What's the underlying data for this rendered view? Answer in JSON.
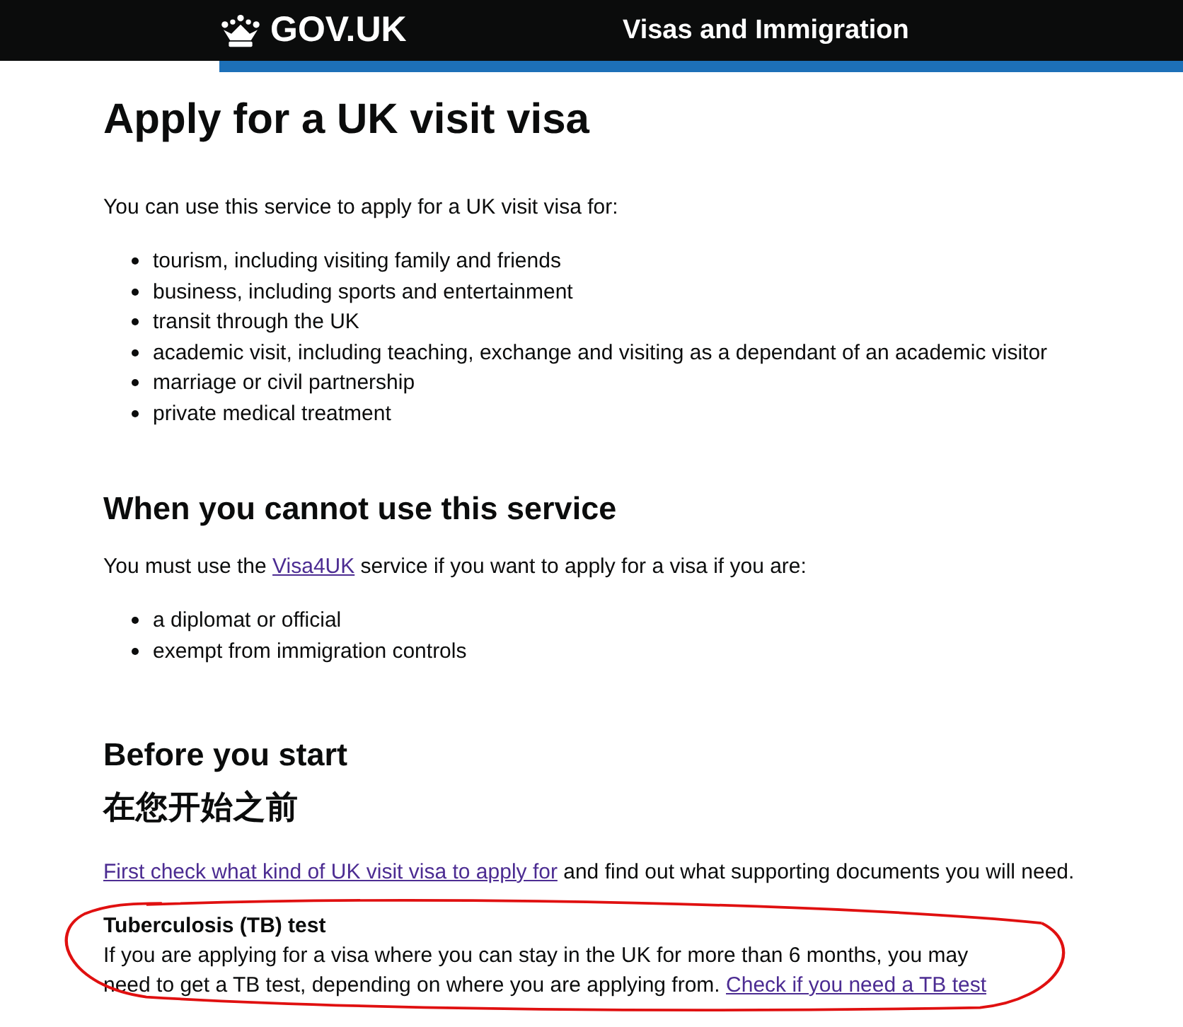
{
  "header": {
    "logo": "GOV.UK",
    "service": "Visas and Immigration"
  },
  "title": "Apply for a UK visit visa",
  "intro": "You can use this service to apply for a UK visit visa for:",
  "uses": [
    "tourism, including visiting family and friends",
    "business, including sports and entertainment",
    "transit through the UK",
    "academic visit, including teaching, exchange and visiting as a dependant of an academic visitor",
    "marriage or civil partnership",
    "private medical treatment"
  ],
  "cannot_use": {
    "heading": "When you cannot use this service",
    "before": "You must use the ",
    "link": "Visa4UK",
    "after": " service if you want to apply for a visa if you are:",
    "items": [
      "a diplomat or official",
      "exempt from immigration controls"
    ]
  },
  "before_you_start": {
    "heading": "Before you start",
    "heading_translation": "在您开始之前",
    "link": "First check what kind of UK visit visa to apply for",
    "after": " and find out what supporting documents you will need."
  },
  "tb_test": {
    "heading": "Tuberculosis (TB) test",
    "text": "If you are applying for a visa where you can stay in the UK for more than 6 months, you may need to get a TB test, depending on where you are applying from. ",
    "link": "Check if you need a TB test",
    "circled": true
  }
}
